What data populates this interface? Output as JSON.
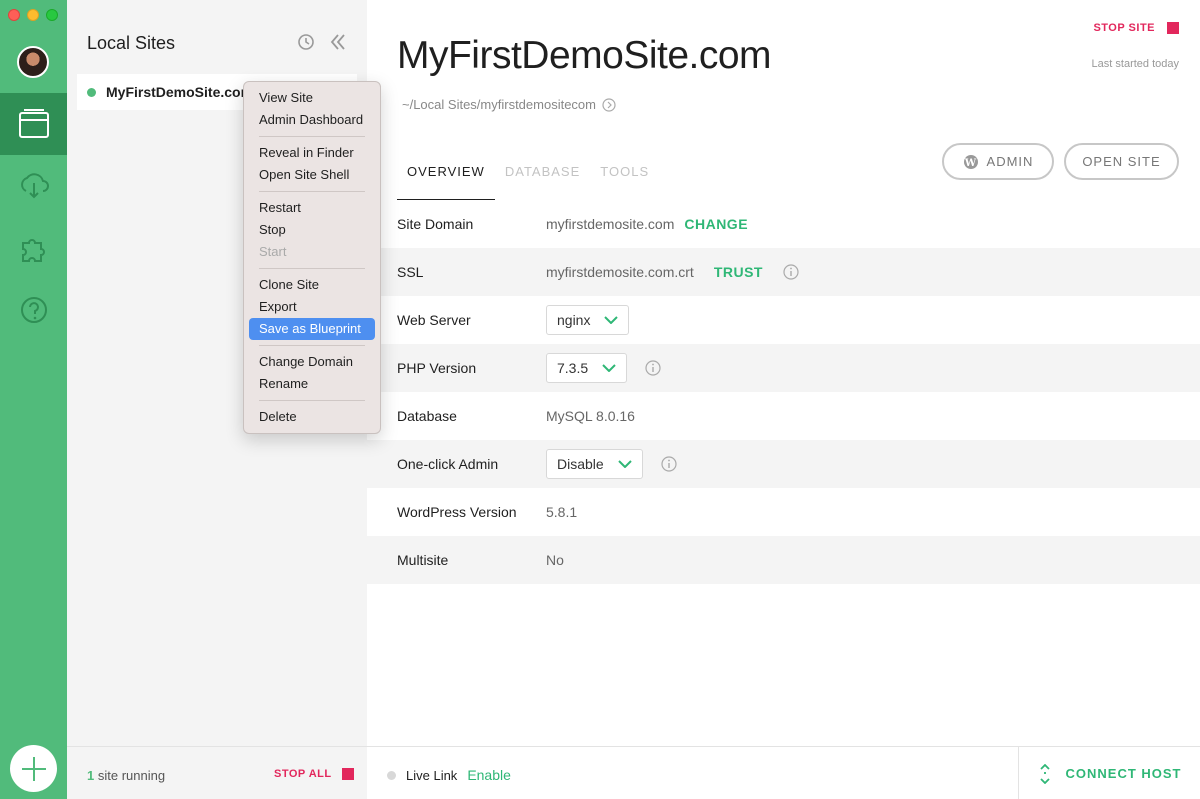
{
  "sidebar": {
    "title": "Local Sites",
    "site_name": "MyFirstDemoSite.com",
    "running_count": "1",
    "running_text": "site running",
    "stop_all": "STOP ALL"
  },
  "context_menu": {
    "groups": [
      [
        "View Site",
        "Admin Dashboard"
      ],
      [
        "Reveal in Finder",
        "Open Site Shell"
      ],
      [
        "Restart",
        "Stop",
        "Start"
      ],
      [
        "Clone Site",
        "Export",
        "Save as Blueprint"
      ],
      [
        "Change Domain",
        "Rename"
      ],
      [
        "Delete"
      ]
    ],
    "view_site": "View Site",
    "admin_dashboard": "Admin Dashboard",
    "reveal": "Reveal in Finder",
    "shell": "Open Site Shell",
    "restart": "Restart",
    "stop": "Stop",
    "start": "Start",
    "clone": "Clone Site",
    "export": "Export",
    "blueprint": "Save as Blueprint",
    "change_domain": "Change Domain",
    "rename": "Rename",
    "delete": "Delete"
  },
  "main": {
    "stop_site": "STOP SITE",
    "last_started": "Last started today",
    "title": "MyFirstDemoSite.com",
    "path": "~/Local Sites/myfirstdemositecom",
    "tabs": [
      "OVERVIEW",
      "DATABASE",
      "TOOLS"
    ],
    "admin_button": "ADMIN",
    "open_site_button": "OPEN SITE"
  },
  "overview": {
    "site_domain_label": "Site Domain",
    "site_domain_value": "myfirstdemosite.com",
    "change": "CHANGE",
    "ssl_label": "SSL",
    "ssl_value": "myfirstdemosite.com.crt",
    "trust": "TRUST",
    "web_server_label": "Web Server",
    "web_server_value": "nginx",
    "php_label": "PHP Version",
    "php_value": "7.3.5",
    "database_label": "Database",
    "database_value": "MySQL 8.0.16",
    "oneclick_label": "One-click Admin",
    "oneclick_value": "Disable",
    "wp_label": "WordPress Version",
    "wp_value": "5.8.1",
    "multisite_label": "Multisite",
    "multisite_value": "No"
  },
  "footer": {
    "live_link": "Live Link",
    "enable": "Enable",
    "connect_host": "CONNECT HOST"
  },
  "colors": {
    "brand_green": "#51bb7b",
    "accent_green": "#2fb776",
    "stop_red": "#e2275c",
    "menu_highlight": "#4e8ff0"
  }
}
